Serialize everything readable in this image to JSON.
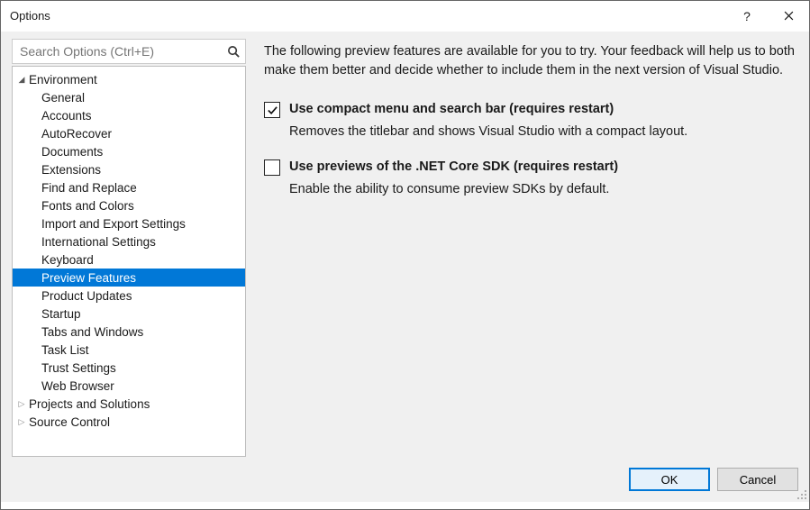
{
  "window": {
    "title": "Options"
  },
  "search": {
    "placeholder": "Search Options (Ctrl+E)"
  },
  "tree": [
    {
      "label": "Environment",
      "depth": 0,
      "expanded": true,
      "selected": false
    },
    {
      "label": "General",
      "depth": 1,
      "selected": false
    },
    {
      "label": "Accounts",
      "depth": 1,
      "selected": false
    },
    {
      "label": "AutoRecover",
      "depth": 1,
      "selected": false
    },
    {
      "label": "Documents",
      "depth": 1,
      "selected": false
    },
    {
      "label": "Extensions",
      "depth": 1,
      "selected": false
    },
    {
      "label": "Find and Replace",
      "depth": 1,
      "selected": false
    },
    {
      "label": "Fonts and Colors",
      "depth": 1,
      "selected": false
    },
    {
      "label": "Import and Export Settings",
      "depth": 1,
      "selected": false
    },
    {
      "label": "International Settings",
      "depth": 1,
      "selected": false
    },
    {
      "label": "Keyboard",
      "depth": 1,
      "selected": false
    },
    {
      "label": "Preview Features",
      "depth": 1,
      "selected": true
    },
    {
      "label": "Product Updates",
      "depth": 1,
      "selected": false
    },
    {
      "label": "Startup",
      "depth": 1,
      "selected": false
    },
    {
      "label": "Tabs and Windows",
      "depth": 1,
      "selected": false
    },
    {
      "label": "Task List",
      "depth": 1,
      "selected": false
    },
    {
      "label": "Trust Settings",
      "depth": 1,
      "selected": false
    },
    {
      "label": "Web Browser",
      "depth": 1,
      "selected": false
    },
    {
      "label": "Projects and Solutions",
      "depth": 0,
      "expanded": false,
      "selected": false
    },
    {
      "label": "Source Control",
      "depth": 0,
      "expanded": false,
      "selected": false
    }
  ],
  "intro": "The following preview features are available for you to try. Your feedback will help us to both make them better and decide whether to include them in the next version of Visual Studio.",
  "features": [
    {
      "checked": true,
      "title": "Use compact menu and search bar (requires restart)",
      "desc": "Removes the titlebar and shows Visual Studio with a compact layout."
    },
    {
      "checked": false,
      "title": "Use previews of the .NET Core SDK (requires restart)",
      "desc": "Enable the ability to consume preview SDKs by default."
    }
  ],
  "buttons": {
    "ok": "OK",
    "cancel": "Cancel"
  }
}
